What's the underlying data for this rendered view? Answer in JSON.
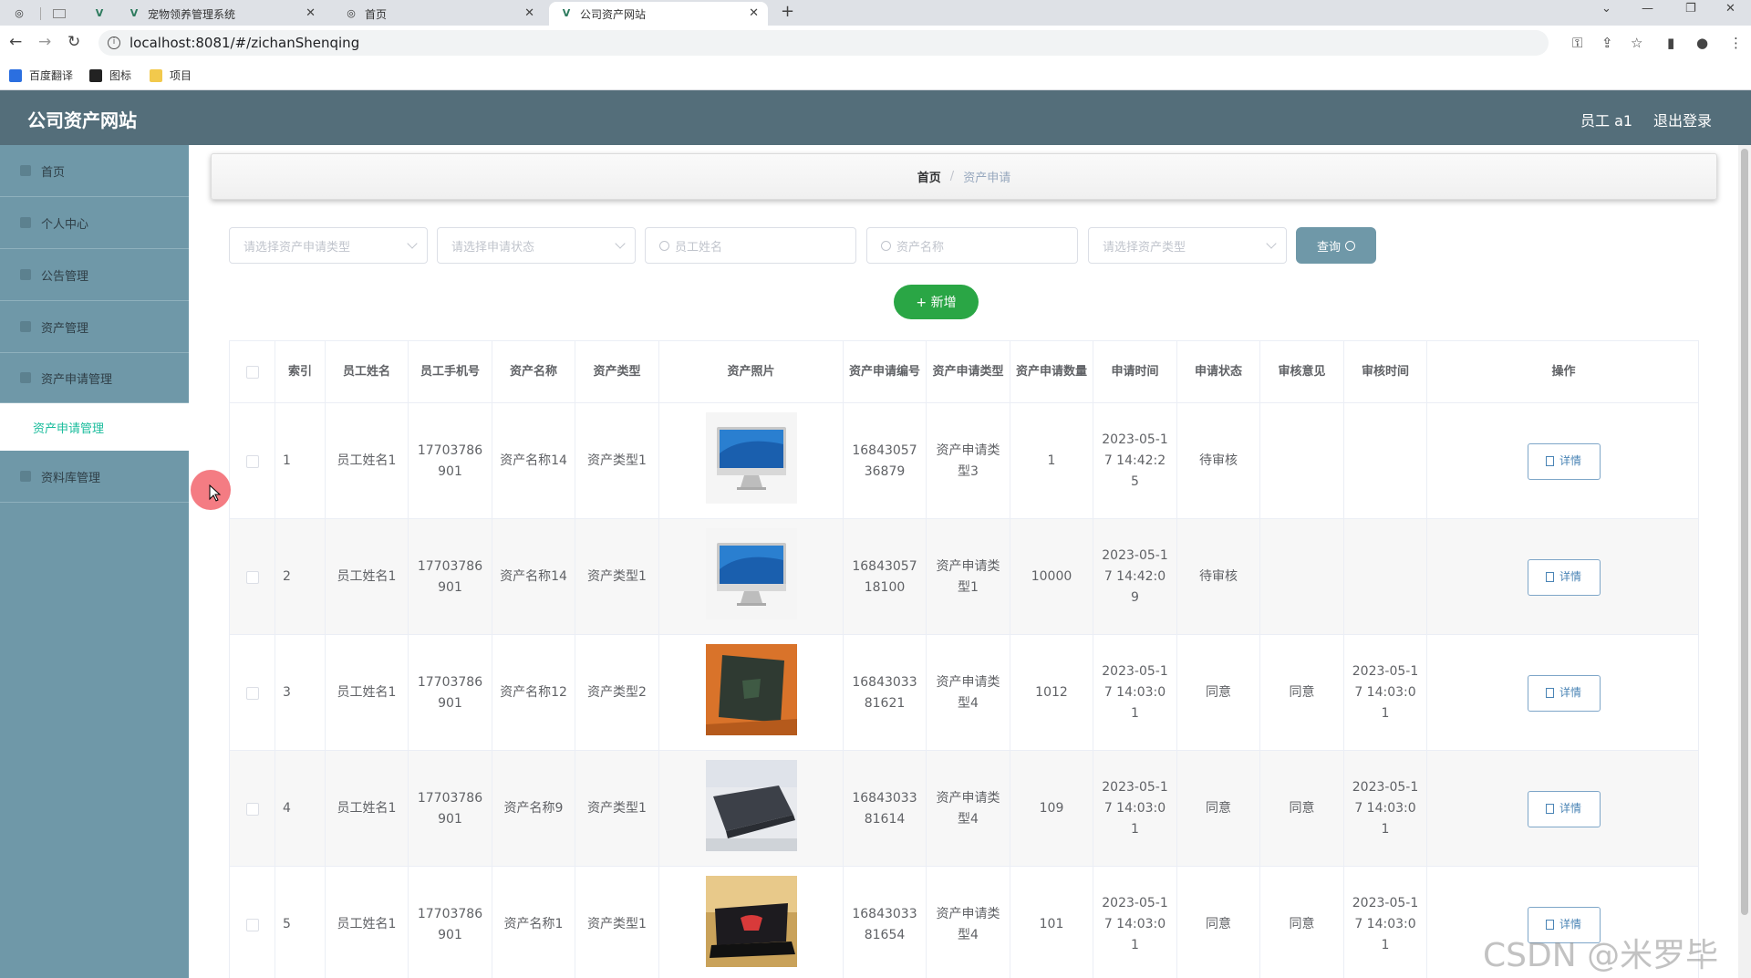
{
  "browser": {
    "tabs": [
      {
        "title": "宠物领养管理系统"
      },
      {
        "title": "首页"
      },
      {
        "title": "公司资产网站"
      }
    ],
    "url": "localhost:8081/#/zichanShenqing",
    "bookmarks": [
      "百度翻译",
      "图标",
      "项目"
    ]
  },
  "header": {
    "title": "公司资产网站",
    "user": "员工 a1",
    "logout": "退出登录"
  },
  "sidebar": {
    "items": [
      "首页",
      "个人中心",
      "公告管理",
      "资产管理",
      "资产申请管理",
      "资料库管理"
    ],
    "active_sub": "资产申请管理"
  },
  "breadcrumb": {
    "home": "首页",
    "current": "资产申请"
  },
  "filters": {
    "apply_type": "请选择资产申请类型",
    "apply_status": "请选择申请状态",
    "employee_name": "员工姓名",
    "asset_name": "资产名称",
    "asset_type": "请选择资产类型",
    "search": "查询",
    "add": "+ 新增"
  },
  "table": {
    "headers": [
      "索引",
      "员工姓名",
      "员工手机号",
      "资产名称",
      "资产类型",
      "资产照片",
      "资产申请编号",
      "资产申请类型",
      "资产申请数量",
      "申请时间",
      "申请状态",
      "审核意见",
      "审核时间",
      "操作"
    ],
    "detail_label": "详情",
    "rows": [
      {
        "index": "1",
        "name": "员工姓名1",
        "phone": "17703786901",
        "asset": "资产名称14",
        "type": "资产类型1",
        "photo": "imac",
        "no": "1684305736879",
        "apply_type": "资产申请类型3",
        "qty": "1",
        "time": "2023-05-17 14:42:25",
        "status": "待审核",
        "opinion": "",
        "review_time": ""
      },
      {
        "index": "2",
        "name": "员工姓名1",
        "phone": "17703786901",
        "asset": "资产名称14",
        "type": "资产类型1",
        "photo": "imac",
        "no": "1684305718100",
        "apply_type": "资产申请类型1",
        "qty": "10000",
        "time": "2023-05-17 14:42:09",
        "status": "待审核",
        "opinion": "",
        "review_time": ""
      },
      {
        "index": "3",
        "name": "员工姓名1",
        "phone": "17703786901",
        "asset": "资产名称12",
        "type": "资产类型2",
        "photo": "laptop-green",
        "no": "1684303381621",
        "apply_type": "资产申请类型4",
        "qty": "1012",
        "time": "2023-05-17 14:03:01",
        "status": "同意",
        "opinion": "同意",
        "review_time": "2023-05-17 14:03:01"
      },
      {
        "index": "4",
        "name": "员工姓名1",
        "phone": "17703786901",
        "asset": "资产名称9",
        "type": "资产类型1",
        "photo": "laptop-gray",
        "no": "1684303381614",
        "apply_type": "资产申请类型4",
        "qty": "109",
        "time": "2023-05-17 14:03:01",
        "status": "同意",
        "opinion": "同意",
        "review_time": "2023-05-17 14:03:01"
      },
      {
        "index": "5",
        "name": "员工姓名1",
        "phone": "17703786901",
        "asset": "资产名称1",
        "type": "资产类型1",
        "photo": "laptop-rog",
        "no": "1684303381654",
        "apply_type": "资产申请类型4",
        "qty": "101",
        "time": "2023-05-17 14:03:01",
        "status": "同意",
        "opinion": "同意",
        "review_time": "2023-05-17 14:03:01"
      }
    ]
  },
  "watermark": "CSDN @米罗毕设",
  "colors": {
    "header": "#546e7a",
    "sidebar": "#6f98a8",
    "accent": "#1abc9c",
    "add": "#2aa645"
  }
}
